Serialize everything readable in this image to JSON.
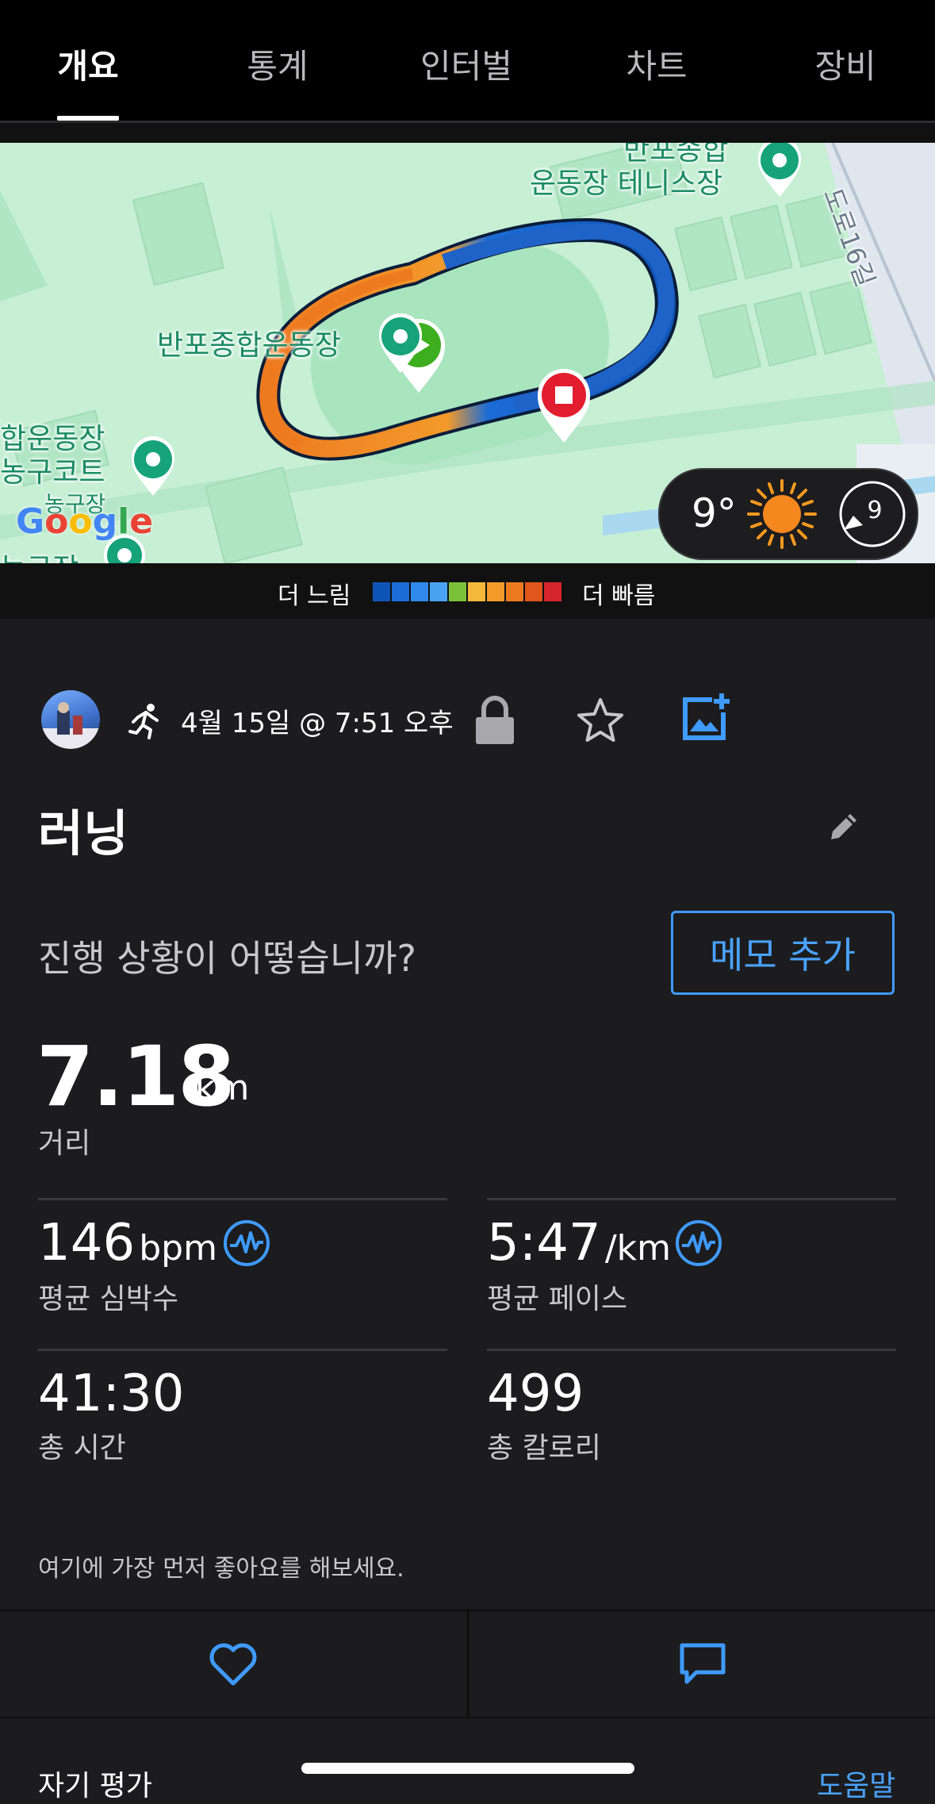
{
  "tabs": [
    "개요",
    "통계",
    "인터벌",
    "차트",
    "장비"
  ],
  "map": {
    "labels": {
      "stadium": "반포종합운동장",
      "tennis_line1": "반포종합",
      "tennis_line2": "운동장 테니스장",
      "basket_line1": "합운동장",
      "basket_line2": "농구코트",
      "basket_line3": "농구장",
      "basket_line4": "농구장",
      "road": "도로16길",
      "google": "Google"
    },
    "weather": {
      "temp": "9°",
      "wind": "9"
    }
  },
  "legend": {
    "slow": "더 느림",
    "fast": "더 빠름",
    "colors": [
      "#0f55b8",
      "#1c6cd6",
      "#3089ea",
      "#4aa3f2",
      "#7cc13a",
      "#f4b93a",
      "#f39a2b",
      "#ee7a20",
      "#e0561b",
      "#d6262b"
    ]
  },
  "activity": {
    "date": "4월 15일 @ 7:51 오후",
    "title": "러닝",
    "question": "진행 상황이 어떻습니까?",
    "memo_button": "메모 추가"
  },
  "stats": {
    "distance": {
      "value": "7.18",
      "unit": "km",
      "label": "거리"
    },
    "heart_rate": {
      "value": "146",
      "unit": "bpm",
      "label": "평균 심박수"
    },
    "pace": {
      "value": "5:47",
      "unit": "/km",
      "label": "평균 페이스"
    },
    "time": {
      "value": "41:30",
      "label": "총 시간"
    },
    "calories": {
      "value": "499",
      "label": "총 칼로리"
    }
  },
  "social": {
    "like_note": "여기에 가장 먼저 좋아요를 해보세요."
  },
  "footer": {
    "self_eval": "자기 평가",
    "help": "도움말"
  }
}
